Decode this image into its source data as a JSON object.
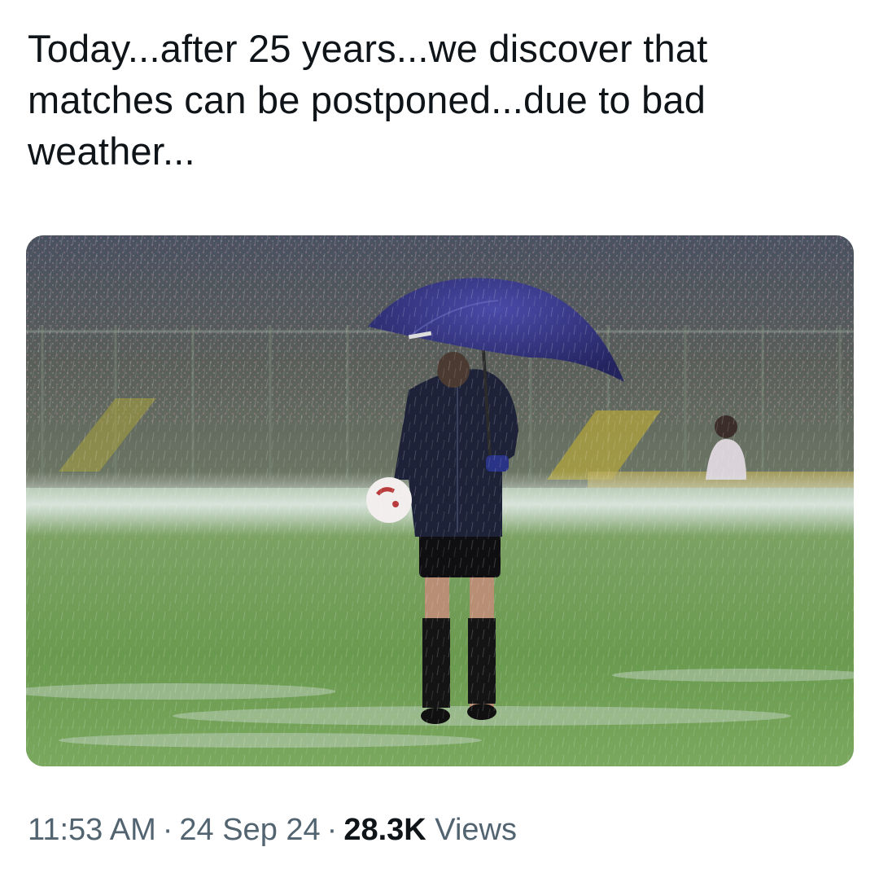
{
  "tweet": {
    "text": "Today...after 25 years...we discover that matches can be postponed...due to bad weather...",
    "time": "11:53 AM",
    "separator": "·",
    "date": "24 Sep 24",
    "views_count": "28.3K",
    "views_label": "Views"
  },
  "media": {
    "alt": "Referee holding an umbrella and a ball on a flooded football pitch in heavy rain"
  },
  "colors": {
    "text_primary": "#0f1419",
    "text_secondary": "#536471",
    "background": "#ffffff"
  }
}
